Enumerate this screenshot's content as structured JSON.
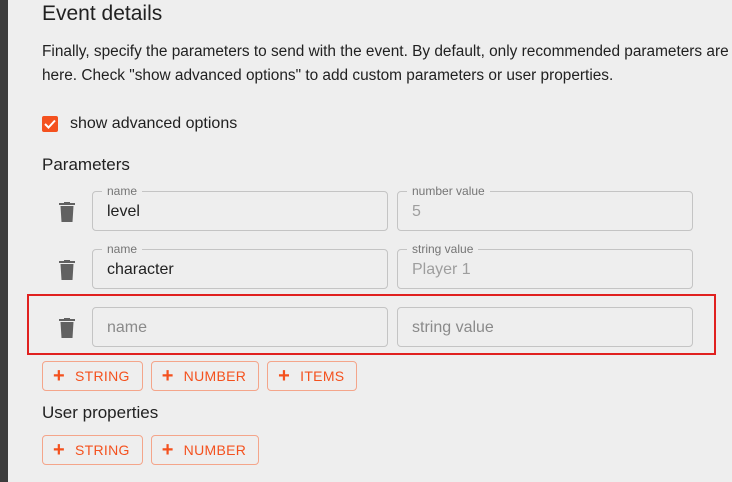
{
  "event_details": {
    "title": "Event details",
    "description_line1": "Finally, specify the parameters to send with the event. By default, only recommended parameters are shown",
    "description_line2": "here. Check \"show advanced options\" to add custom parameters or user properties."
  },
  "advanced_options": {
    "label": "show advanced options",
    "checked": true
  },
  "parameters": {
    "title": "Parameters",
    "rows": [
      {
        "name_label": "name",
        "name_value": "level",
        "value_label": "number value",
        "value_value": "5"
      },
      {
        "name_label": "name",
        "name_value": "character",
        "value_label": "string value",
        "value_value": "Player 1"
      },
      {
        "name_placeholder": "name",
        "value_placeholder": "string value"
      }
    ],
    "add_buttons": [
      "STRING",
      "NUMBER",
      "ITEMS"
    ]
  },
  "user_properties": {
    "title": "User properties",
    "add_buttons": [
      "STRING",
      "NUMBER"
    ]
  },
  "icons": {
    "plus": "+",
    "delete": "trash-icon",
    "check": "check-icon"
  },
  "colors": {
    "accent": "#f4511e",
    "highlight": "#e0201f"
  }
}
